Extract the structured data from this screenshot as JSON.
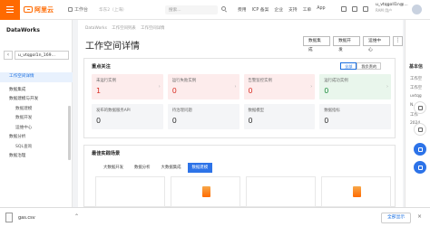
{
  "topbar": {
    "logo": "阿里云",
    "workspace_chip": "工作台",
    "region": "华东2（上海）",
    "search_placeholder": "搜索...",
    "nav": [
      "费用",
      "ICP 备案",
      "企业",
      "支持",
      "工单",
      "App"
    ],
    "user_name": "u_vtqgoll1n@...",
    "user_sub": "RAM 用户"
  },
  "sidebar": {
    "title": "DataWorks",
    "back": "‹",
    "workspace": "u_vtqgol1n_169...",
    "items": [
      {
        "label": "工作空间详情",
        "type": "item",
        "active": true
      },
      {
        "label": "数据集成",
        "type": "item"
      },
      {
        "label": "数据建模与开发",
        "type": "item"
      },
      {
        "label": "数据建模",
        "type": "sub"
      },
      {
        "label": "数据开发",
        "type": "sub"
      },
      {
        "label": "运维中心",
        "type": "sub"
      },
      {
        "label": "数据分析",
        "type": "item"
      },
      {
        "label": "SQL查询",
        "type": "sub"
      },
      {
        "label": "数据治理",
        "type": "item"
      }
    ]
  },
  "main": {
    "breadcrumb": [
      "DataWorks",
      "工作空间列表",
      "工作空间详情"
    ],
    "title": "工作空间详情",
    "buttons": [
      "数据集成",
      "数据开发",
      "运维中心"
    ],
    "more": "⋮",
    "focus": {
      "title": "重点关注",
      "toggle": [
        "全部",
        "我负责的"
      ],
      "row1": [
        {
          "label": "未运行实例",
          "value": "1",
          "tone": "red"
        },
        {
          "label": "运行失败实例",
          "value": "0",
          "tone": "red"
        },
        {
          "label": "告警监控实例",
          "value": "0",
          "tone": "red"
        },
        {
          "label": "运行成功实例",
          "value": "0",
          "tone": "green"
        }
      ],
      "row2": [
        {
          "label": "发布的数据服务API",
          "value": "0"
        },
        {
          "label": "待治理问题",
          "value": "0"
        },
        {
          "label": "数据模型",
          "value": "0"
        },
        {
          "label": "数据指标",
          "value": "0"
        }
      ]
    },
    "practice": {
      "title": "最佳实践场景",
      "tabs": [
        "大数据开发",
        "数据分析",
        "大数据集成",
        "数据建模"
      ],
      "active_tab": 3
    }
  },
  "rail": {
    "title": "基本信",
    "lines": [
      "工作空",
      "工作空",
      "uvtqg",
      "N...",
      "工作",
      "2024"
    ]
  },
  "download": {
    "filename": "gas.csv",
    "show_all": "全部显示",
    "close": "×"
  }
}
